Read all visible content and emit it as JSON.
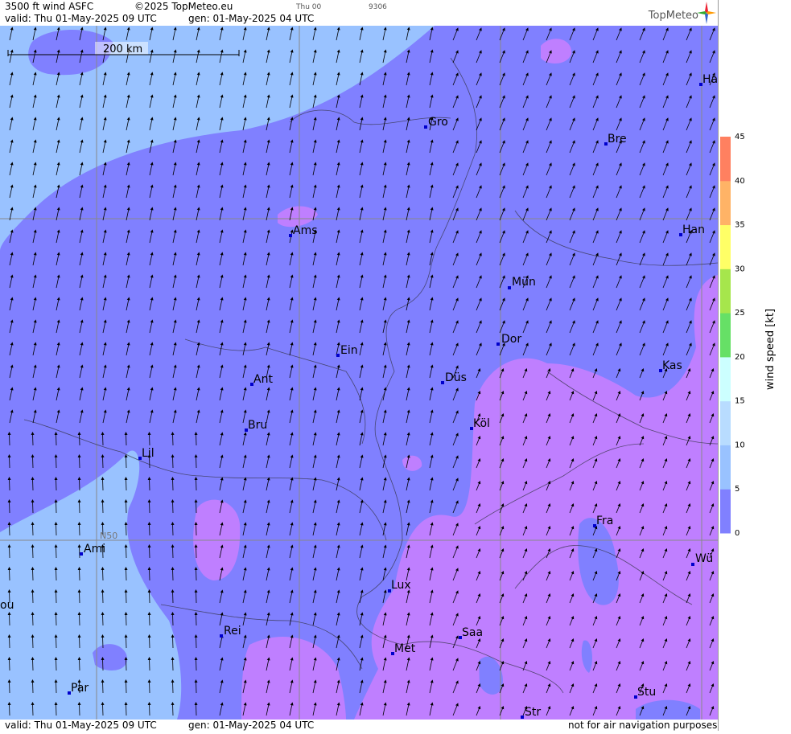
{
  "header": {
    "title": "3500 ft wind ASFC",
    "copyright": "©2025 TopMeteo.eu",
    "valid": "valid:  Thu  01-May-2025  09 UTC",
    "gen": "gen: 01-May-2025 04 UTC",
    "small_day": "Thu 00",
    "small_code": "9306",
    "logo": "TopMeteo"
  },
  "footer": {
    "valid": "valid:  Thu  01-May-2025  09 UTC",
    "gen": "gen: 01-May-2025 04 UTC",
    "disclaimer": "not for air navigation purposes"
  },
  "map": {
    "scale_label": "200 km",
    "lat_label": "N50",
    "cities": [
      {
        "name": "Gro"
      },
      {
        "name": "Bre"
      },
      {
        "name": "Ha"
      },
      {
        "name": "Ams"
      },
      {
        "name": "Han"
      },
      {
        "name": "Mün"
      },
      {
        "name": "Ein"
      },
      {
        "name": "Dor"
      },
      {
        "name": "Ant"
      },
      {
        "name": "Düs"
      },
      {
        "name": "Kas"
      },
      {
        "name": "Bru"
      },
      {
        "name": "Köl"
      },
      {
        "name": "Lil"
      },
      {
        "name": "Fra"
      },
      {
        "name": "Ami"
      },
      {
        "name": "Wü"
      },
      {
        "name": "Lux"
      },
      {
        "name": "ou"
      },
      {
        "name": "Rei"
      },
      {
        "name": "Saa"
      },
      {
        "name": "Met"
      },
      {
        "name": "Par"
      },
      {
        "name": "Stu"
      },
      {
        "name": "Str"
      }
    ]
  },
  "legend": {
    "title": "wind speed [kt]",
    "ticks": [
      "45",
      "40",
      "35",
      "30",
      "25",
      "20",
      "15",
      "10",
      "5",
      "0"
    ],
    "colors": [
      "#bf7fff",
      "#8080ff",
      "#99c2ff",
      "#b8dcff",
      "#ccffff",
      "#66e066",
      "#a6e64c",
      "#ffff66",
      "#ffb366",
      "#ff8060"
    ]
  }
}
